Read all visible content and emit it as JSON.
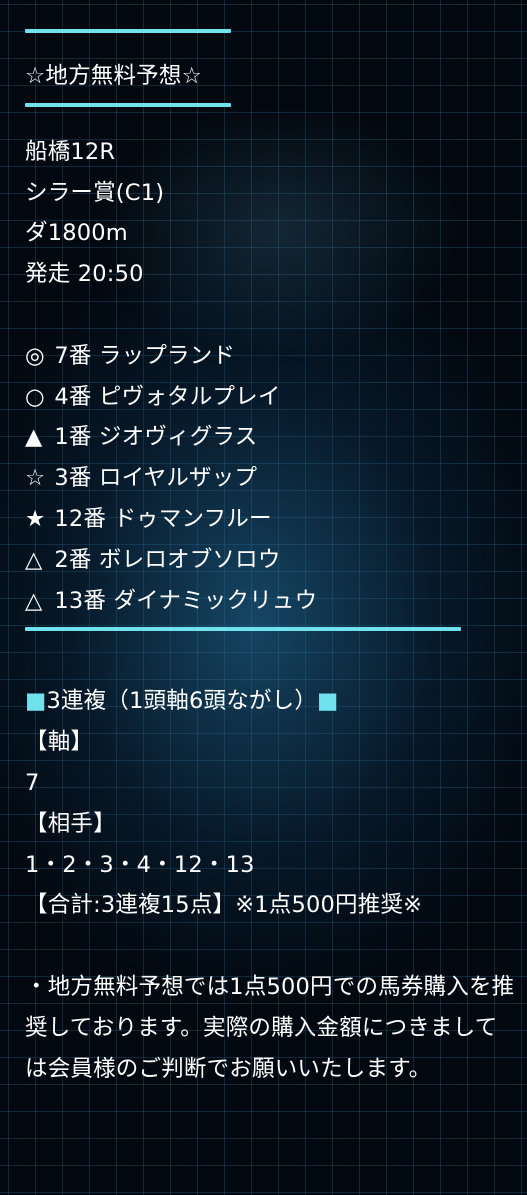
{
  "title": "☆地方無料予想☆",
  "race": {
    "venue_race": "船橋12R",
    "name": "シラー賞(C1)",
    "course": "ダ1800m",
    "start": "発走 20:50"
  },
  "picks": [
    {
      "mark": "◎",
      "text": "7番 ラップランド"
    },
    {
      "mark": "○",
      "text": "4番 ピヴォタルプレイ"
    },
    {
      "mark": "▲",
      "text": "1番 ジオヴィグラス"
    },
    {
      "mark": "☆",
      "text": "3番 ロイヤルザップ"
    },
    {
      "mark": "★",
      "text": "12番 ドゥマンフルー"
    },
    {
      "mark": "△",
      "text": "2番 ボレロオブソロウ"
    },
    {
      "mark": "△",
      "text": "13番 ダイナミックリュウ"
    }
  ],
  "bet": {
    "square_mark": "■",
    "type_label": "3連複（1頭軸6頭ながし）",
    "axis_header": "【軸】",
    "axis_value": "7",
    "partner_header": "【相手】",
    "partner_value": "1・2・3・4・12・13",
    "total": "【合計:3連複15点】※1点500円推奨※"
  },
  "note": "・地方無料予想では1点500円での馬券購入を推奨しております。実際の購入金額につきましては会員様のご判断でお願いいたします。",
  "colors": {
    "accent": "#6fe2ee",
    "text": "#ffffff",
    "background": "#02080f"
  }
}
